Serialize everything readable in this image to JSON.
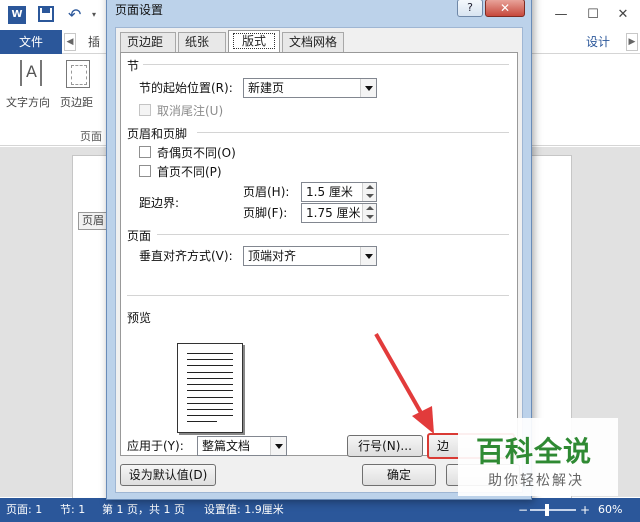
{
  "word": {
    "title_icons": {
      "logo": "W",
      "undo": "↶",
      "undo_dropdown": "▾"
    },
    "window": {
      "help": "?",
      "minimize": "—",
      "maximize": "☐",
      "close": "✕"
    },
    "ribbon_tabs": {
      "file": "文件",
      "insert_partial": "插",
      "design": "设计",
      "scroll_left": "◀",
      "scroll_right": "▶"
    },
    "ribbon": {
      "text_direction": "文字方向",
      "margins": "页边距",
      "group_page": "页面"
    },
    "doc": {
      "header_tag": "页眉"
    },
    "statusbar": {
      "page": "页面: 1",
      "section": "节: 1",
      "page_of": "第 1 页，共 1 页",
      "setting": "设置值: 1.9厘米",
      "zoom_minus": "−",
      "zoom_plus": "+",
      "zoom_pct": "60%"
    }
  },
  "dialog": {
    "title": "页面设置",
    "help": "?",
    "close": "✕",
    "tabs": [
      "页边距",
      "纸张",
      "版式",
      "文档网格"
    ],
    "active_tab": "版式",
    "section_group": {
      "label": "节",
      "start_label": "节的起始位置(R):",
      "start_value": "新建页",
      "suppress_endnotes": "取消尾注(U)"
    },
    "header_footer_group": {
      "label": "页眉和页脚",
      "odd_even": "奇偶页不同(O)",
      "first_page": "首页不同(P)",
      "from_edge": "距边界:",
      "header_label": "页眉(H):",
      "header_value": "1.5 厘米",
      "footer_label": "页脚(F):",
      "footer_value": "1.75 厘米"
    },
    "page_group": {
      "label": "页面",
      "valign_label": "垂直对齐方式(V):",
      "valign_value": "顶端对齐"
    },
    "preview": {
      "label": "预览"
    },
    "apply_to": {
      "label": "应用于(Y):",
      "value": "整篇文档"
    },
    "buttons": {
      "line_numbers": "行号(N)...",
      "borders": "边",
      "set_default": "设为默认值(D)",
      "ok": "确定"
    }
  },
  "watermark": {
    "logo": "百科全说",
    "slogan": "助你轻松解决"
  },
  "colors": {
    "word_blue": "#2b579a",
    "dialog_frame": "#bcd2ea",
    "highlight_red": "#d93a34",
    "watermark_green": "#2f8a33"
  }
}
